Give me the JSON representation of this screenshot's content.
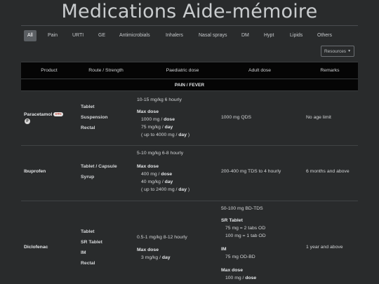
{
  "page": {
    "title": "Medications Aide-mémoire"
  },
  "tabs": [
    "All",
    "Pain",
    "URTI",
    "GE",
    "Antimicrobials",
    "Inhalers",
    "Nasal sprays",
    "DM",
    "Hypt",
    "Lipids",
    "Others"
  ],
  "resources": {
    "label": "Resources"
  },
  "table": {
    "headers": [
      "Product",
      "Route / Strength",
      "Paediatric dose",
      "Adult dose",
      "Remarks"
    ],
    "section": "PAIN / FEVER"
  },
  "drugs": {
    "paracetamol": {
      "name": "Paracetamol",
      "badge": "OTC",
      "badge2": "P",
      "routes": [
        "Tablet",
        "Suspension",
        "Rectal"
      ],
      "paed_freq": "10-15 mg/kg 6 hourly",
      "paed_max": "Max dose",
      "paed_l1a": "1000 mg / ",
      "paed_l1b": "dose",
      "paed_l2a": "75 mg/kg / ",
      "paed_l2b": "day",
      "paed_l3a": "( up to 4000 mg / ",
      "paed_l3b": "day",
      "paed_l3c": " )",
      "adult": "1000 mg QDS",
      "remarks": "No age limit"
    },
    "ibuprofen": {
      "name": "Ibuprofen",
      "routes": [
        "Tablet / Capsule",
        "Syrup"
      ],
      "paed_freq": "5-10 mg/kg 6-8 hourly",
      "paed_max": "Max dose",
      "paed_l1a": "400 mg / ",
      "paed_l1b": "dose",
      "paed_l2a": "40 mg/kg / ",
      "paed_l2b": "day",
      "paed_l3a": "( up to 2400 mg / ",
      "paed_l3b": "day",
      "paed_l3c": " )",
      "adult": "200-400 mg TDS to 4 hourly",
      "remarks": "6 months and above"
    },
    "diclofenac": {
      "name": "Diclofenac",
      "routes": [
        "Tablet",
        "SR Tablet",
        "IM",
        "Rectal"
      ],
      "paed_freq": "0.5-1 mg/kg 8-12 hourly",
      "paed_max": "Max dose",
      "paed_l1a": "3 mg/kg / ",
      "paed_l1b": "day",
      "adult_freq": "50-100 mg BD-TDS",
      "adult_sr": "SR Tablet",
      "adult_sr1": "75 mg = 2 tabs OD",
      "adult_sr2": "100 mg = 1 tab OD",
      "adult_im": "IM",
      "adult_im1": "75 mg OD-BD",
      "adult_max": "Max dose",
      "adult_max1a": "100 mg / ",
      "adult_max1b": "dose",
      "remarks": "1 year and above"
    }
  }
}
